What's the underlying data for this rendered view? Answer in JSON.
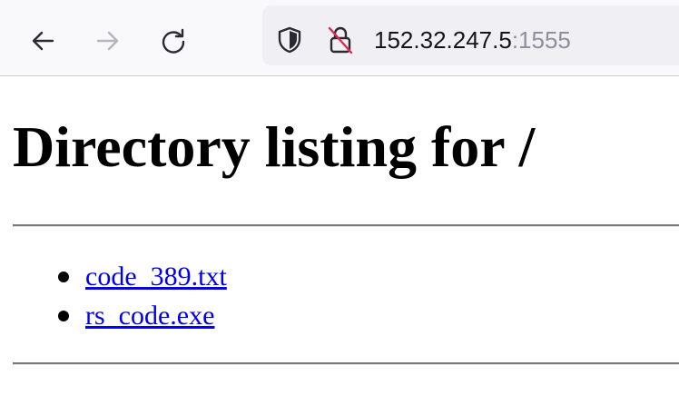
{
  "browser": {
    "url_host": "152.32.247.5",
    "url_port": ":1555",
    "icons": {
      "back": "arrow-left-icon",
      "forward": "arrow-right-icon",
      "reload": "reload-icon",
      "tracking_protection": "shield-icon",
      "insecure_connection": "lock-insecure-icon"
    },
    "forward_enabled": false
  },
  "page": {
    "heading": "Directory listing for /",
    "files": [
      {
        "name": "code_389.txt"
      },
      {
        "name": "rs_code.exe"
      }
    ],
    "link_color": "#0000ee"
  }
}
